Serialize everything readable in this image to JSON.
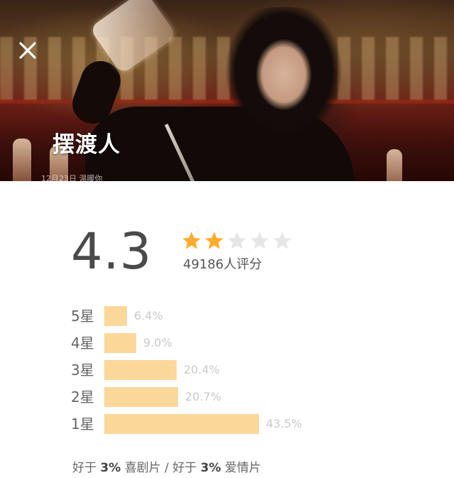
{
  "hero": {
    "title": "摆渡人",
    "caption": "12月23日 温暖你",
    "close_icon": "close-icon"
  },
  "rating": {
    "score": "4.3",
    "stars_filled": 2,
    "stars_total": 5,
    "count_text": "49186人评分",
    "star_color": "#ffac2d",
    "star_empty_color": "#e6e6e6"
  },
  "distribution": [
    {
      "label": "5星",
      "percent_text": "6.4%",
      "percent": 6.4
    },
    {
      "label": "4星",
      "percent_text": "9.0%",
      "percent": 9.0
    },
    {
      "label": "3星",
      "percent_text": "20.4%",
      "percent": 20.4
    },
    {
      "label": "2星",
      "percent_text": "20.7%",
      "percent": 20.7
    },
    {
      "label": "1星",
      "percent_text": "43.5%",
      "percent": 43.5
    }
  ],
  "bar_color": "#fbd79a",
  "genre": {
    "prefix1": "好于",
    "value1": "3%",
    "genre1": "喜剧片",
    "separator": " / ",
    "prefix2": "好于",
    "value2": "3%",
    "genre2": "爱情片"
  }
}
